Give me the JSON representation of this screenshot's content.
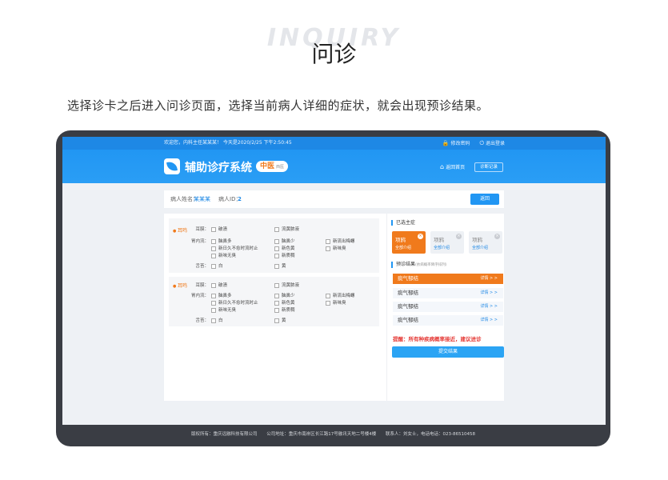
{
  "bg_word": "INQUIRY",
  "title": "问诊",
  "description": "选择诊卡之后进入问诊页面，选择当前病人详细的症状，就会出现预诊结果。",
  "topbar": {
    "welcome": "欢迎您，内科主任某某某！ 今天是2020/2/25 下午2:50:45",
    "change_password": "修改密码",
    "logout": "退出登录"
  },
  "header": {
    "system_title": "辅助诊疗系统",
    "badge": "中医",
    "badge_sub": "西医",
    "home": "返回首页",
    "records": "诊断记录"
  },
  "patient": {
    "name_label": "病人姓名：",
    "name": "某某某",
    "id_label": "病人ID：",
    "id": "2",
    "back": "返回"
  },
  "symptom_blocks": [
    {
      "category": "耳鸣",
      "ear_label": "耳膜：",
      "ear_opts": [
        "破溃",
        "流黄脓液"
      ],
      "chest_label": "胃内流：",
      "chest_col1": [
        "脑鼻多",
        "新日久不愈时流时止",
        "新味无臭"
      ],
      "chest_col2": [
        "脑鼻少",
        "新色黄",
        "新质稠"
      ],
      "chest_col3": [
        "新流出梅螺",
        "新味臭"
      ],
      "tongue_label": "舌苔：",
      "tongue_opts": [
        "白",
        "黄"
      ]
    },
    {
      "category": "耳鸣",
      "ear_label": "耳膜：",
      "ear_opts": [
        "破溃",
        "流黄脓液"
      ],
      "chest_label": "胃内流：",
      "chest_col1": [
        "脑鼻多",
        "新日久不愈时流时止",
        "新味无臭"
      ],
      "chest_col2": [
        "脑鼻少",
        "新色黄",
        "新质稠"
      ],
      "chest_col3": [
        "新流出梅螺",
        "新味臭"
      ],
      "tongue_label": "舌苔：",
      "tongue_opts": [
        "白",
        "黄"
      ]
    }
  ],
  "selected": {
    "title": "已选主症",
    "cards": [
      {
        "name": "项鸦",
        "sub": "全部介绍",
        "active": true
      },
      {
        "name": "项鸦",
        "sub": "全部介绍",
        "active": false
      },
      {
        "name": "项鸦",
        "sub": "全部介绍",
        "active": false
      }
    ]
  },
  "results": {
    "title": "预诊结果",
    "subtitle": "(依病概率降序排列)",
    "items": [
      {
        "name": "痰气郁结",
        "detail": "详情 > >",
        "active": true
      },
      {
        "name": "痰气郁结",
        "detail": "详情 > >",
        "active": false
      },
      {
        "name": "痰气郁结",
        "detail": "详情 > >",
        "active": false
      },
      {
        "name": "痰气郁结",
        "detail": "详情 > >",
        "active": false
      }
    ],
    "warning": "提醒：所有种疾病概率接近，建议进诊",
    "submit": "提交结果"
  },
  "footer": {
    "copyright": "版权所有：重庆远融科技有限公司",
    "address": "公司地址：重庆市南岸区长江路17号融讯天地二号楼4楼",
    "contact": "联系人：刘女士，电话电话：023-86510458"
  },
  "colors": {
    "primary": "#2196f3",
    "accent": "#f07a1c",
    "warning": "#e53935"
  }
}
